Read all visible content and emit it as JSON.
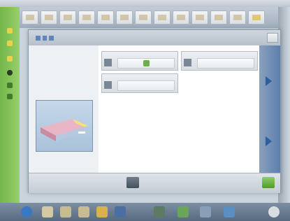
{
  "window": {
    "title": ""
  },
  "toolbar": {
    "buttons": [
      {
        "icon": "document-icon"
      },
      {
        "icon": "document-icon"
      },
      {
        "icon": "document-icon"
      },
      {
        "icon": "document-icon"
      },
      {
        "icon": "document-icon"
      },
      {
        "icon": "document-icon"
      },
      {
        "icon": "document-icon"
      },
      {
        "icon": "document-icon"
      },
      {
        "icon": "document-icon"
      },
      {
        "icon": "document-icon"
      },
      {
        "icon": "document-icon"
      },
      {
        "icon": "document-icon"
      },
      {
        "icon": "document-icon"
      },
      {
        "icon": "folder-icon"
      }
    ]
  },
  "dialog": {
    "title": "",
    "faded_label": "",
    "fields": [
      {
        "caption": "",
        "value": "",
        "icon": "check-icon"
      },
      {
        "caption": "",
        "value": "",
        "icon": "value-icon"
      },
      {
        "caption": "",
        "value": "",
        "icon": "value-icon"
      }
    ]
  },
  "colors": {
    "accent_green": "#73b64a",
    "dialog_bg": "#eef1f4",
    "nav_blue": "#2e5e9e",
    "taskbar": "#566a80"
  }
}
